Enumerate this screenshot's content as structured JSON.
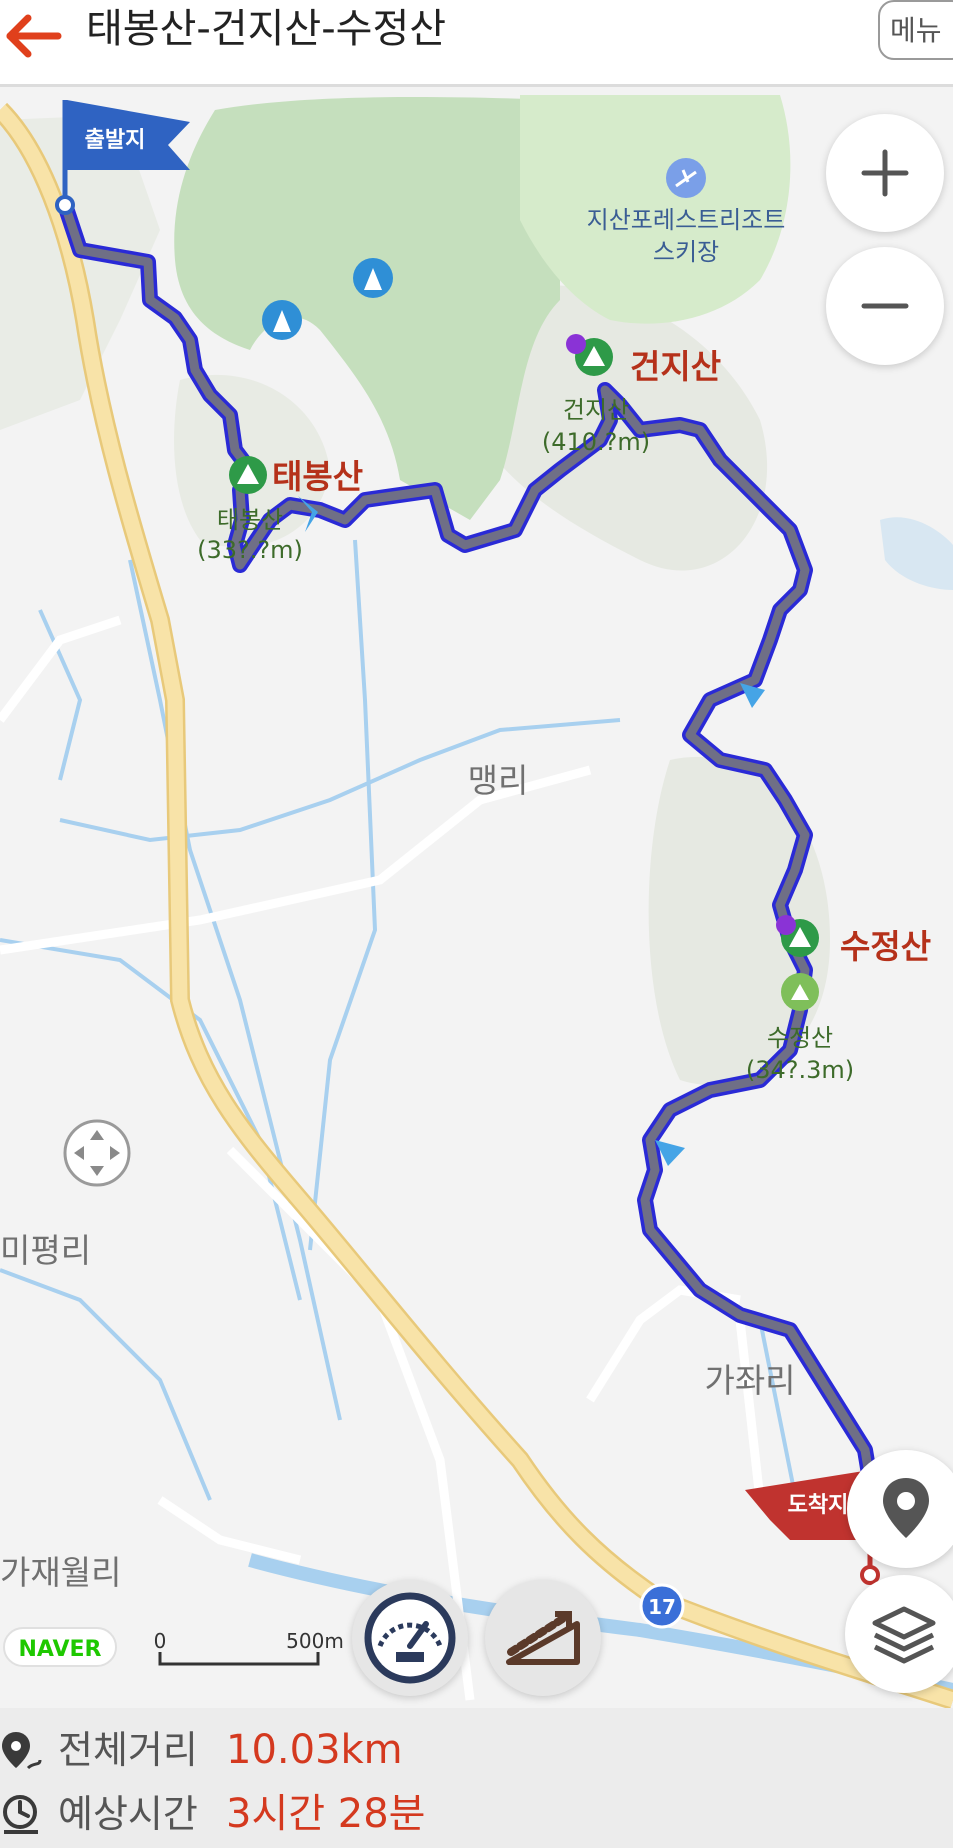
{
  "header": {
    "title": "태봉산-건지산-수정산",
    "menu_label": "메뉴"
  },
  "map": {
    "start_flag": "출발지",
    "end_flag": "도착지",
    "peaks": [
      {
        "name": "태봉산",
        "label_line1": "태봉산",
        "label_line2": "(33?.?m)"
      },
      {
        "name": "건지산",
        "label_line1": "건지산",
        "label_line2": "(410.?m)"
      },
      {
        "name": "수정산",
        "label_line1": "수정산",
        "label_line2": "(34?.3m)"
      }
    ],
    "poi": {
      "line1": "지산포레스트리조트",
      "line2": "스키장"
    },
    "villages": [
      "맹리",
      "미평리",
      "가좌리",
      "가재월리"
    ],
    "road_number": "17",
    "brand": "NAVER",
    "scale": {
      "zero": "0",
      "max": "500m"
    },
    "controls": {
      "zoom_in": "+",
      "zoom_out": "−"
    },
    "colors": {
      "route": "#6f6f86",
      "route_outline": "#2a2ad6",
      "road": "#f6dc97",
      "forest": "#c5dfbd",
      "water": "#a8d0ef",
      "start_flag": "#2f63c2",
      "end_flag": "#c0332f",
      "peak_name": "#b5311a"
    }
  },
  "summary": {
    "distance_label": "전체거리",
    "distance_value": "10.03km",
    "time_label": "예상시간",
    "time_value": "3시간 28분"
  }
}
